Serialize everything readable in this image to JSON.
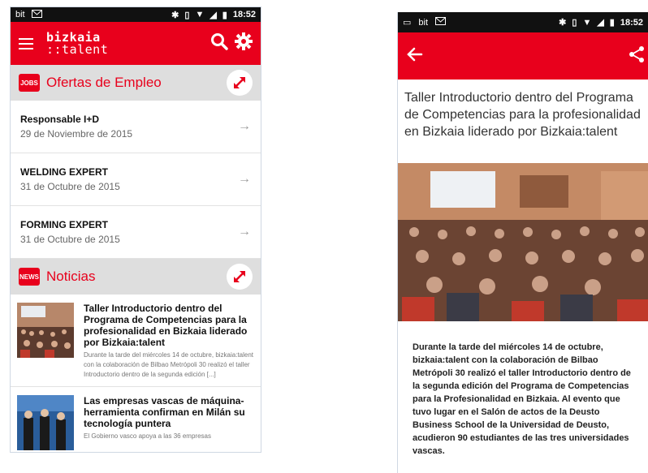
{
  "left": {
    "status": {
      "carrier": "bit",
      "time": "18:52"
    },
    "app": {
      "logo_line1": "bizkaia",
      "logo_line2": "::talent"
    },
    "jobs_section": {
      "icon_label": "JOBS",
      "title": "Ofertas de Empleo",
      "items": [
        {
          "title": "Responsable I+D",
          "date": "29 de Noviembre de 2015"
        },
        {
          "title": "WELDING EXPERT",
          "date": "31 de Octubre de 2015"
        },
        {
          "title": "FORMING EXPERT",
          "date": "31 de Octubre de 2015"
        }
      ]
    },
    "news_section": {
      "icon_label": "NEWS",
      "title": "Noticias",
      "items": [
        {
          "title": "Taller Introductorio dentro del Programa de Competencias para la profesionalidad en Bizkaia liderado por Bizkaia:talent",
          "excerpt": "Durante la tarde del miércoles 14 de octubre, bizkaia:talent con la colaboración de Bilbao Metrópoli 30 realizó el taller Introductorio dentro de la segunda edición [...]"
        },
        {
          "title": "Las empresas vascas de máquina-herramienta confirman en Milán su tecnología puntera",
          "excerpt": "El Gobierno vasco apoya a las 36 empresas"
        }
      ]
    }
  },
  "right": {
    "status": {
      "carrier": "bit",
      "time": "18:52"
    },
    "article": {
      "title": "Taller Introductorio dentro del Programa de Competencias para la profesionalidad en Bizkaia liderado por Bizkaia:talent",
      "body": "Durante la tarde del miércoles 14 de octubre, bizkaia:talent con la colaboración de Bilbao Metrópoli 30 realizó el taller Introductorio dentro de la segunda edición del Programa de Competencias para la Profesionalidad en Bizkaia. Al evento que tuvo lugar en el Salón de actos de la Deusto Business School de la Universidad de Deusto, acudieron 90 estudiantes de las tres universidades vascas."
    }
  },
  "colors": {
    "brand_red": "#e8001c",
    "section_grey": "#dedede"
  },
  "icons": [
    "menu-icon",
    "search-icon",
    "gear-icon",
    "jobs-icon",
    "news-icon",
    "expand-icon",
    "chevron-right-icon",
    "back-arrow-icon",
    "share-icon",
    "bluetooth-icon",
    "vibrate-icon",
    "wifi-icon",
    "signal-icon",
    "battery-icon",
    "mail-icon"
  ]
}
